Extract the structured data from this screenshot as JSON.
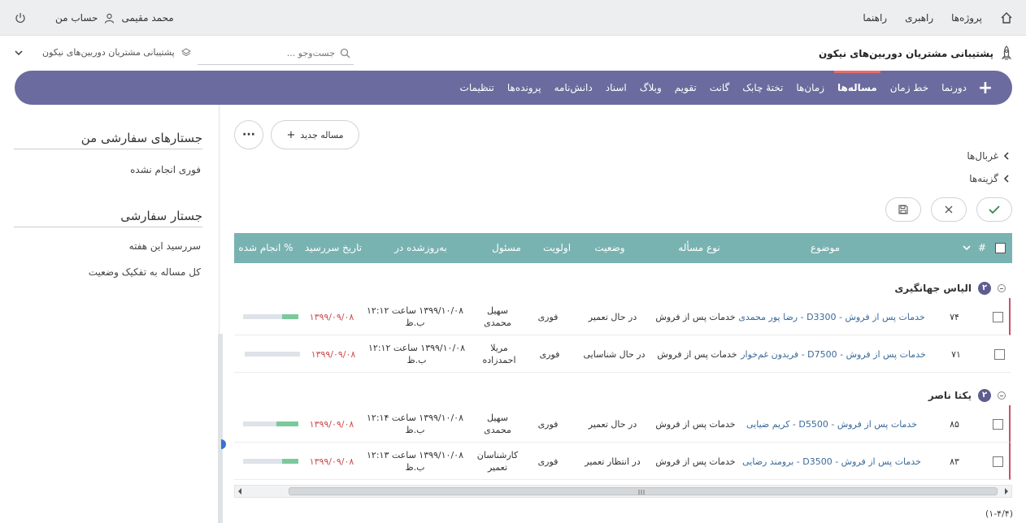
{
  "topbar": {
    "nav": [
      "پروژه‌ها",
      "راهبری",
      "راهنما"
    ],
    "user_name": "محمد مقیمی",
    "account": "حساب من"
  },
  "header": {
    "project_title": "پشتیبانی مشتریان دوربین‌های نیکون",
    "search_placeholder": "جست‌وجو ...",
    "project_select": "پشتیبانی مشتریان دوربین‌های نیکون"
  },
  "nav": {
    "items": [
      "دورنما",
      "خط زمان",
      "مساله‌ها",
      "زمان‌ها",
      "تختهٔ چابک",
      "گانت",
      "تقویم",
      "وبلاگ",
      "اسناد",
      "دانش‌نامه",
      "پرونده‌ها",
      "تنظیمات"
    ],
    "active_index": 2
  },
  "sidebar": {
    "my_queries_title": "جستارهای سفارشی من",
    "my_queries": [
      "فوری انجام نشده"
    ],
    "queries_title": "جستار سفارشی",
    "queries": [
      "سررسید این هفته",
      "کل مساله به تفکیک وضعیت"
    ]
  },
  "toolbar": {
    "new_issue": "مساله جدید",
    "more": "···",
    "filters": "غربال‌ها",
    "options": "گزینه‌ها"
  },
  "table": {
    "headers": {
      "num": "#",
      "subject": "موضوع",
      "type": "نوع مسأله",
      "status": "وضعیت",
      "priority": "اولویت",
      "assignee": "مسئول",
      "updated": "به‌روزشده در",
      "due": "تاریخ سررسید",
      "done": "% انجام شده"
    },
    "groups": [
      {
        "name": "الیاس جهانگیری",
        "count": "۲",
        "rows": [
          {
            "id": "۷۴",
            "subject": "خدمات پس از فروش - D3300 - رضا پور محمدی",
            "type": "خدمات پس از فروش",
            "status": "در حال تعمیر",
            "priority": "فوری",
            "assignee1": "سهیل",
            "assignee2": "محمدی",
            "updated": "۱۳۹۹/۱۰/۰۸ ساعت ۱۲:۱۲ ب.ظ",
            "due": "۱۳۹۹/۰۹/۰۸",
            "done": 0.3
          },
          {
            "id": "۷۱",
            "subject": "خدمات پس از فروش - D7500 - فریدون غم‌خوار",
            "type": "خدمات پس از فروش",
            "status": "در حال شناسایی",
            "priority": "فوری",
            "assignee1": "مریلا",
            "assignee2": "احمدزاده",
            "updated": "۱۳۹۹/۱۰/۰۸ ساعت ۱۲:۱۲ ب.ظ",
            "due": "۱۳۹۹/۰۹/۰۸",
            "done": 0
          }
        ]
      },
      {
        "name": "یکتا ناصر",
        "count": "۲",
        "rows": [
          {
            "id": "۸۵",
            "subject": "خدمات پس از فروش - D5500 - کریم ضیایی",
            "type": "خدمات پس از فروش",
            "status": "در حال تعمیر",
            "priority": "فوری",
            "assignee1": "سهیل",
            "assignee2": "محمدی",
            "updated": "۱۳۹۹/۱۰/۰۸ ساعت ۱۲:۱۴ ب.ظ",
            "due": "۱۳۹۹/۰۹/۰۸",
            "done": 0.4
          },
          {
            "id": "۸۳",
            "subject": "خدمات پس از فروش - D3500 - برومند رضایی",
            "type": "خدمات پس از فروش",
            "status": "در انتظار تعمیر",
            "priority": "فوری",
            "assignee1": "کارشناسان",
            "assignee2": "تعمیر",
            "updated": "۱۳۹۹/۱۰/۰۸ ساعت ۱۲:۱۳ ب.ظ",
            "due": "۱۳۹۹/۰۹/۰۸",
            "done": 0.3
          }
        ]
      }
    ]
  },
  "pagination": "(۱-۴/۴)",
  "colors": {
    "nav_bg": "#6b6b9f",
    "table_head": "#78b3b2",
    "accent_red": "#e86b6b",
    "progress": "#7bc99b"
  }
}
